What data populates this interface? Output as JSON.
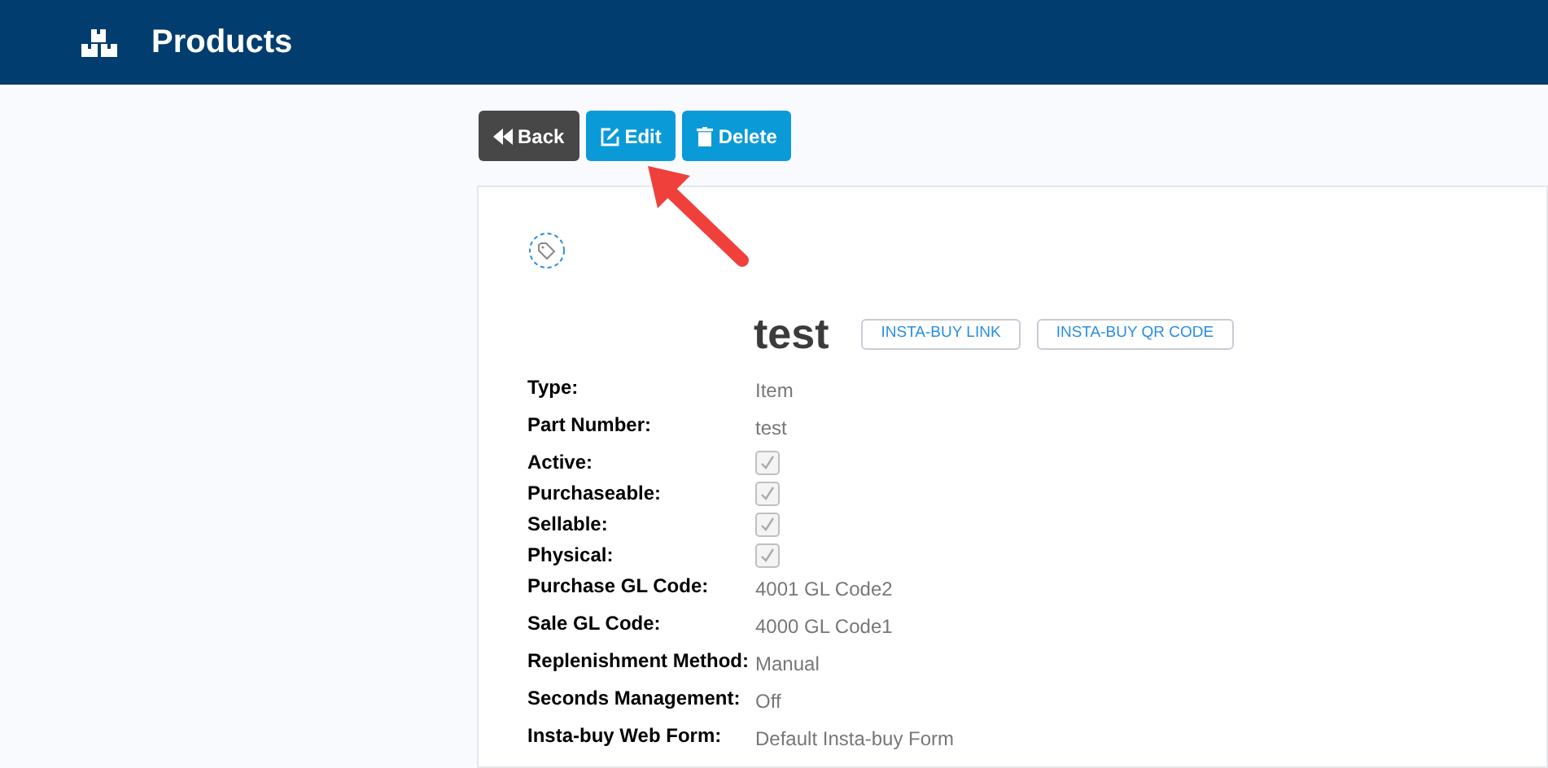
{
  "header": {
    "title": "Products"
  },
  "actions": [
    {
      "label": "Back",
      "kind": "back"
    },
    {
      "label": "Edit",
      "kind": "edit"
    },
    {
      "label": "Delete",
      "kind": "delete"
    }
  ],
  "product": {
    "name": "test",
    "links": [
      "INSTA-BUY LINK",
      "INSTA-BUY QR CODE"
    ],
    "fields": [
      {
        "label": "Type:",
        "kind": "text",
        "value": "Item"
      },
      {
        "label": "Part Number:",
        "kind": "text",
        "value": "test"
      },
      {
        "label": "Active:",
        "kind": "checkbox",
        "checked": true
      },
      {
        "label": "Purchaseable:",
        "kind": "checkbox",
        "checked": true
      },
      {
        "label": "Sellable:",
        "kind": "checkbox",
        "checked": true
      },
      {
        "label": "Physical:",
        "kind": "checkbox",
        "checked": true
      },
      {
        "label": "Purchase GL Code:",
        "kind": "text",
        "value": "4001 GL Code2"
      },
      {
        "label": "Sale GL Code:",
        "kind": "text",
        "value": "4000 GL Code1"
      },
      {
        "label": "Replenishment Method:",
        "kind": "text",
        "value": "Manual"
      },
      {
        "label": "Seconds Management:",
        "kind": "text",
        "value": "Off"
      },
      {
        "label": "Insta-buy Web Form:",
        "kind": "text",
        "value": "Default Insta-buy Form"
      }
    ]
  }
}
